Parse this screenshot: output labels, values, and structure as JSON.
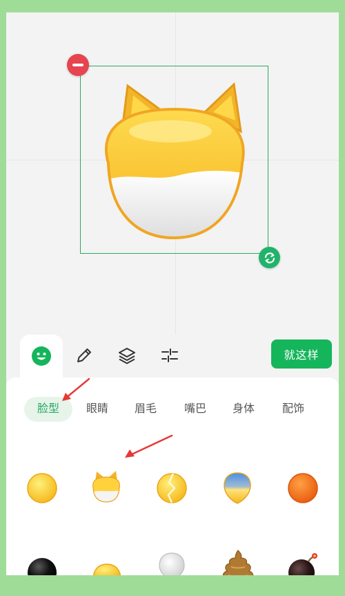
{
  "toolbar": {
    "tools": [
      "smiley-icon",
      "pencil-icon",
      "layers-icon",
      "adjust-icon"
    ],
    "done_label": "就这样"
  },
  "categories": [
    "脸型",
    "眼睛",
    "眉毛",
    "嘴巴",
    "身体",
    "配饰"
  ],
  "active_category": "脸型",
  "colors": {
    "accent": "#15b55c",
    "delete": "#e6444e",
    "frame": "#9fdc98",
    "annotation_arrow": "#e53935"
  },
  "face_items": [
    "yellow-face",
    "cat-face",
    "cracked-face",
    "blue-yellow-face",
    "orange-face",
    "black-face",
    "half-yellow-face",
    "white-bulb-face",
    "poop-face",
    "bomb-face"
  ]
}
